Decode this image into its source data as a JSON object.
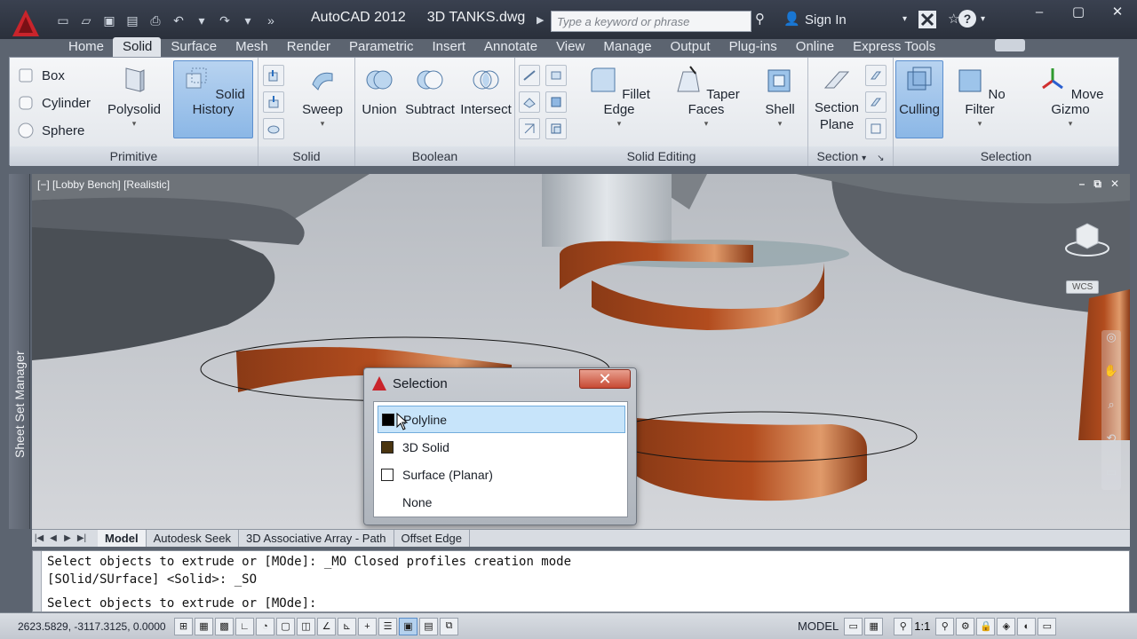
{
  "title_bar": {
    "app_name": "AutoCAD 2012",
    "file_name": "3D TANKS.dwg",
    "search_placeholder": "Type a keyword or phrase",
    "sign_in": "Sign In"
  },
  "tabs": [
    "Home",
    "Solid",
    "Surface",
    "Mesh",
    "Render",
    "Parametric",
    "Insert",
    "Annotate",
    "View",
    "Manage",
    "Output",
    "Plug-ins",
    "Online",
    "Express Tools"
  ],
  "active_tab": "Solid",
  "ribbon": {
    "primitive": {
      "title": "Primitive",
      "box": "Box",
      "cylinder": "Cylinder",
      "sphere": "Sphere",
      "polysolid": "Polysolid",
      "solid_history": "Solid History"
    },
    "solid": {
      "title": "Solid",
      "sweep": "Sweep"
    },
    "boolean": {
      "title": "Boolean",
      "union": "Union",
      "subtract": "Subtract",
      "intersect": "Intersect"
    },
    "solid_editing": {
      "title": "Solid Editing",
      "fillet_edge": "Fillet Edge",
      "taper_faces": "Taper Faces",
      "shell": "Shell"
    },
    "section": {
      "title": "Section",
      "section_plane_1": "Section",
      "section_plane_2": "Plane"
    },
    "selection": {
      "title": "Selection",
      "culling": "Culling",
      "no_filter": "No Filter",
      "move_gizmo": "Move Gizmo"
    }
  },
  "sheet_set_manager": "Sheet Set Manager",
  "viewport": {
    "label": "[−] [Lobby Bench] [Realistic]",
    "wcs": "WCS"
  },
  "dialog": {
    "title": "Selection",
    "items": [
      {
        "label": "Polyline",
        "color": "#000000",
        "selected": true
      },
      {
        "label": "3D Solid",
        "color": "#4a3510",
        "selected": false
      },
      {
        "label": "Surface (Planar)",
        "color": "#ffffff",
        "selected": false
      },
      {
        "label": "None",
        "color": "",
        "selected": false
      }
    ]
  },
  "layout_tabs": [
    "Model",
    "Autodesk Seek",
    "3D Associative Array - Path",
    "Offset Edge"
  ],
  "command_lines": [
    "Select objects to extrude or [MOde]: _MO Closed profiles creation mode",
    "[SOlid/SUrface] <Solid>: _SO",
    "Select objects to extrude or [MOde]:"
  ],
  "status": {
    "coordinates": "2623.5829, -3117.3125, 0.0000",
    "space": "MODEL",
    "scale": "1:1"
  }
}
